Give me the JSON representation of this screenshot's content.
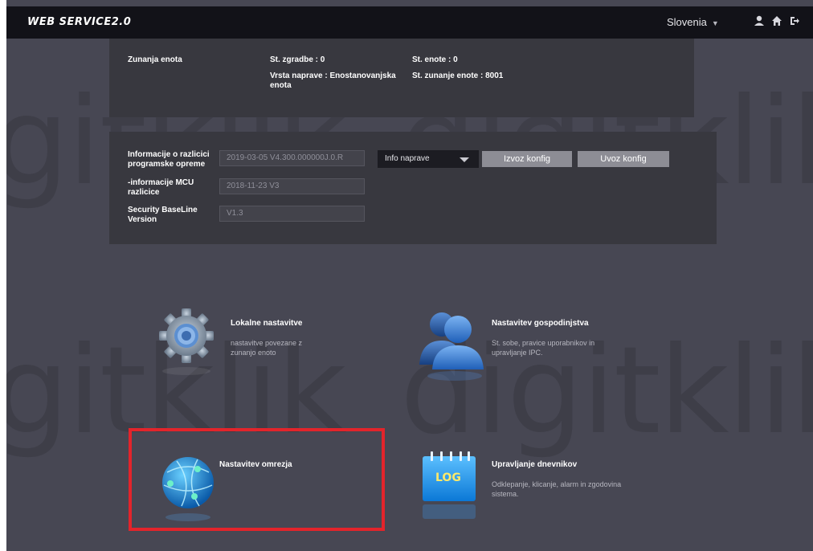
{
  "header": {
    "brand": "WEB SERVICE2.0",
    "language": "Slovenia",
    "icons": [
      "user-icon",
      "home-icon",
      "logout-icon"
    ]
  },
  "device": {
    "unit_label": "Zunanja enota",
    "building_no": "St. zgradbe : 0",
    "unit_no": "St. enote : 0",
    "device_type": "Vrsta naprave : Enostanovanjska enota",
    "outdoor_unit_no": "St. zunanje enote : 8001"
  },
  "version": {
    "software_label": "Informacije o razlicici programske opreme",
    "software_value": "2019-03-05 V4.300.000000J.0.R",
    "mcu_label": "-informacije MCU razlicice",
    "mcu_value": "2018-11-23 V3",
    "baseline_label": "Security BaseLine Version",
    "baseline_value": "V1.3",
    "info_select": "Info naprave",
    "export_button": "Izvoz konfig",
    "import_button": "Uvoz konfig"
  },
  "tiles": {
    "local": {
      "title": "Lokalne nastavitve",
      "desc": "nastavitve povezane z zunanjo enoto"
    },
    "household": {
      "title": "Nastavitev gospodinjstva",
      "desc": "St. sobe, pravice uporabnikov in upravljanje IPC."
    },
    "network": {
      "title": "Nastavitev omrezja"
    },
    "log": {
      "title": "Upravljanje dnevnikov",
      "desc": "Odklepanje, klicanje, alarm in zgodovina sistema.",
      "badge": "LOG"
    }
  },
  "watermark": "digitklik",
  "colors": {
    "highlight": "#e3242b",
    "topbar": "#121218",
    "background": "#474753"
  }
}
